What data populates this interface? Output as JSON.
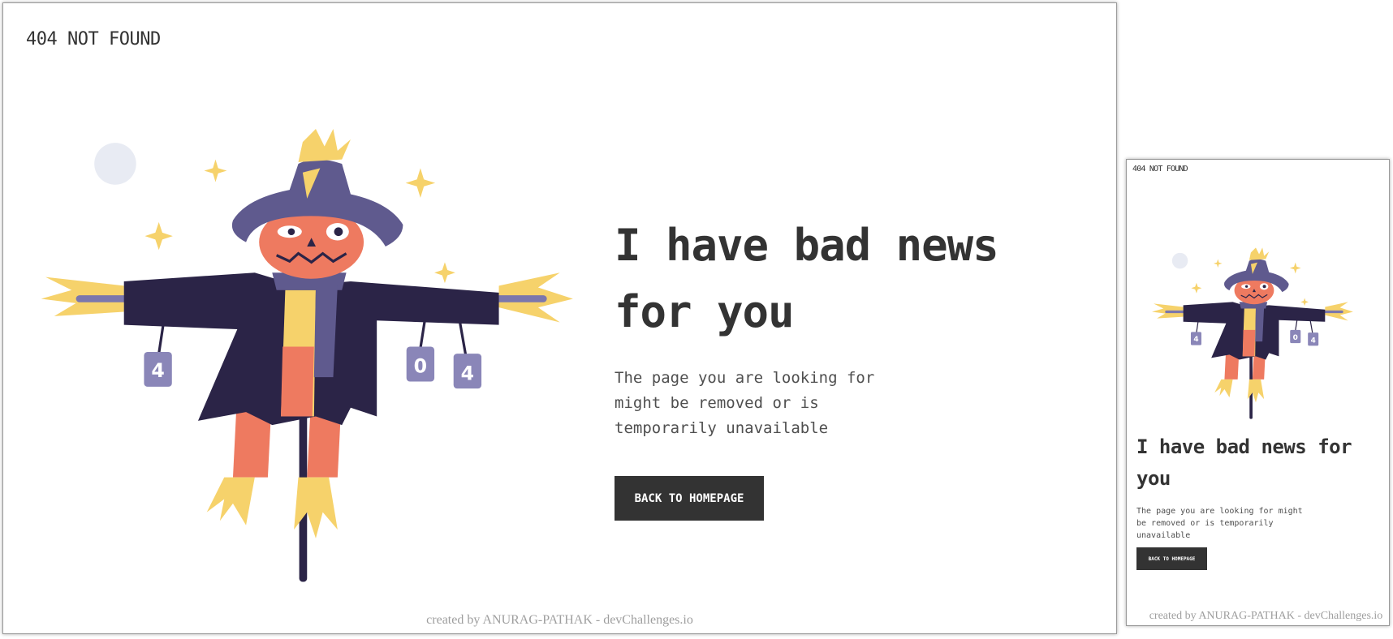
{
  "brand": {
    "logo_text": "404 NOT FOUND"
  },
  "hero": {
    "headline": "I have bad news for you",
    "subtext": "The page you are looking for might be removed or is temporarily unavailable",
    "can_labels": [
      "4",
      "0",
      "4"
    ]
  },
  "actions": {
    "back_button_label": "BACK TO HOMEPAGE"
  },
  "footer": {
    "credit": "created by ANURAG-PATHAK - devChallenges.io"
  },
  "colors": {
    "text": "#333333",
    "button_bg": "#333333",
    "button_text": "#ffffff",
    "hat": "#5f5a8e",
    "coat": "#2b2447",
    "face": "#ee7a60",
    "straw": "#f6d26b",
    "can": "#8a86b8",
    "moon": "#e8ebf3"
  }
}
